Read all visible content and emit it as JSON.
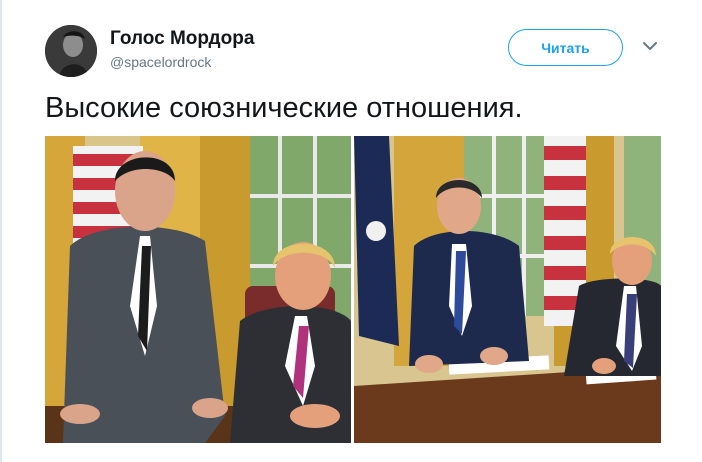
{
  "tweet": {
    "display_name": "Голос Мордора",
    "handle": "@spacelordrock",
    "follow_label": "Читать",
    "text": "Высокие союзнические отношения."
  },
  "icons": {
    "avatar": "avatar-photo",
    "menu": "chevron-down-icon"
  },
  "colors": {
    "accent": "#1da1f2",
    "secondary_text": "#657786"
  }
}
